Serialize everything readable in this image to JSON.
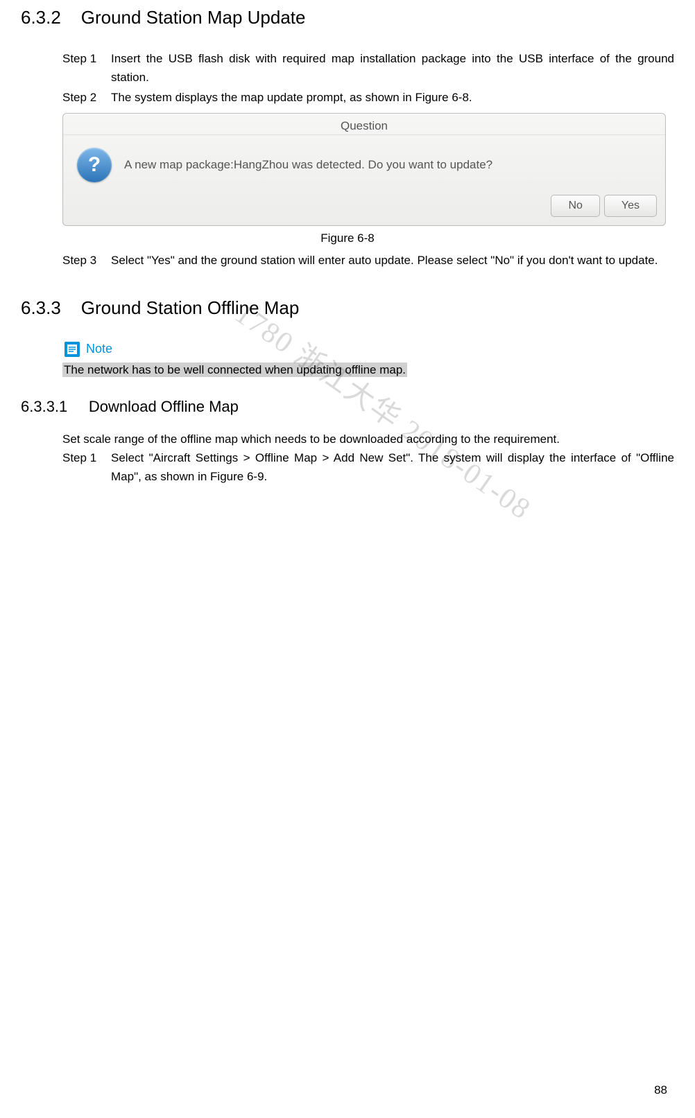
{
  "sections": {
    "s632": {
      "num": "6.3.2",
      "title": "Ground Station Map Update"
    },
    "s633": {
      "num": "6.3.3",
      "title": "Ground Station Offline Map"
    },
    "s6331": {
      "num": "6.3.3.1",
      "title": "Download Offline Map"
    }
  },
  "steps632": {
    "step1_label": "Step 1",
    "step1_text": "Insert the USB flash disk with required map installation package into the USB interface of the ground station.",
    "step2_label": "Step 2",
    "step2_text": "The system displays the map update prompt, as shown in Figure 6-8.",
    "step3_label": "Step 3",
    "step3_text": "Select \"Yes\" and the ground station will enter auto update. Please select \"No\" if you don't want to update."
  },
  "dialog": {
    "title": "Question",
    "message": "A new map package:HangZhou was detected. Do you want to update?",
    "btn_no": "No",
    "btn_yes": "Yes"
  },
  "figure68": "Figure 6-8",
  "note": {
    "label": "Note",
    "text": "The network has to be well connected when updating offline map."
  },
  "s6331_intro": "Set scale range of the offline map which needs to be downloaded according to the requirement.",
  "steps6331": {
    "step1_label": "Step 1",
    "step1_text": "Select \"Aircraft Settings > Offline Map > Add New Set\". The system will display the interface of \"Offline Map\", as shown in Figure 6-9."
  },
  "watermark": "1780 浙江大华 2018-01-08",
  "page_number": "88"
}
